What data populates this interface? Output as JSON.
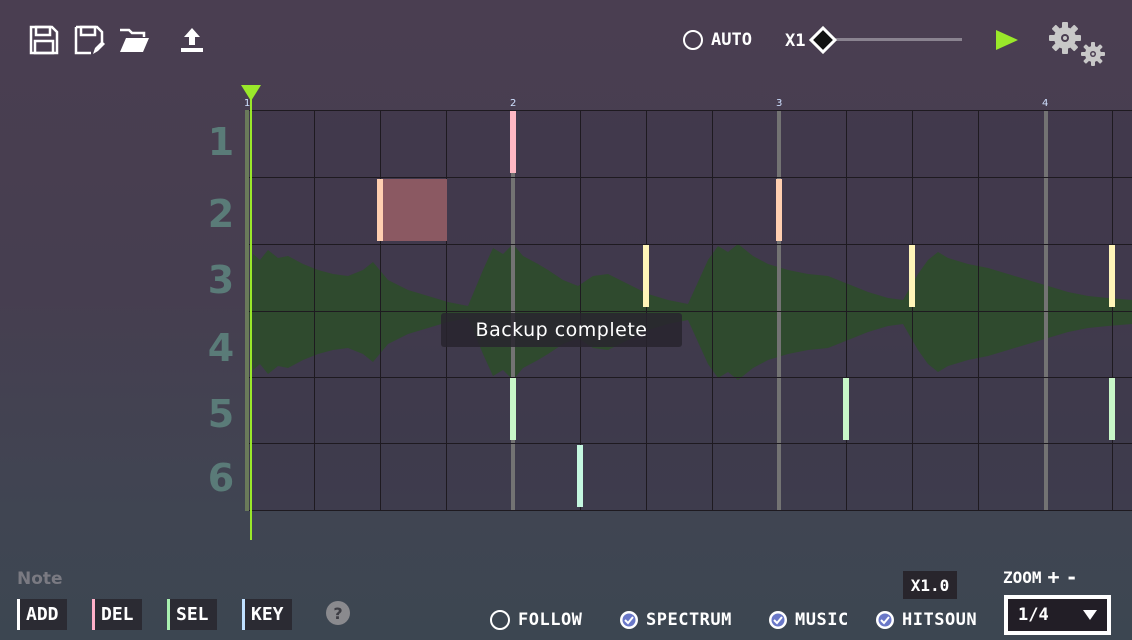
{
  "toolbar": {
    "icons": [
      "save-icon",
      "save-as-icon",
      "open-folder-icon",
      "upload-icon"
    ],
    "auto_label": "AUTO",
    "speed_label": "X1",
    "speed_value": 0,
    "play_color": "#9ae82a"
  },
  "editor": {
    "row_labels": [
      "1",
      "2",
      "3",
      "4",
      "5",
      "6"
    ],
    "measure_labels": [
      "1",
      "2",
      "3",
      "4"
    ],
    "playhead_color": "#9ae82a",
    "toast": "Backup complete"
  },
  "notes_panel": {
    "title": "Note",
    "tools": [
      {
        "label": "ADD",
        "color": "#ffffff"
      },
      {
        "label": "DEL",
        "color": "#ffb0c8"
      },
      {
        "label": "SEL",
        "color": "#a8f0b0"
      },
      {
        "label": "KEY",
        "color": "#bfe0ff"
      }
    ],
    "help_icon": "question-icon"
  },
  "bottom_options": {
    "follow": {
      "label": "FOLLOW",
      "checked": false
    },
    "spectrum": {
      "label": "SPECTRUM",
      "checked": true
    },
    "music": {
      "label": "MUSIC",
      "checked": true
    },
    "hitsound": {
      "label": "HITSOUN",
      "checked": true
    }
  },
  "rate_badge": "X1.0",
  "zoom": {
    "label": "ZOOM",
    "plus": "+",
    "minus": "-",
    "selected": "1/4"
  },
  "note_colors": {
    "row1": "#ffb8c4",
    "row2": "#ffcfb0",
    "row3": "#fff5b8",
    "row5": "#c8f7c8",
    "row6": "#c4f7e0"
  }
}
